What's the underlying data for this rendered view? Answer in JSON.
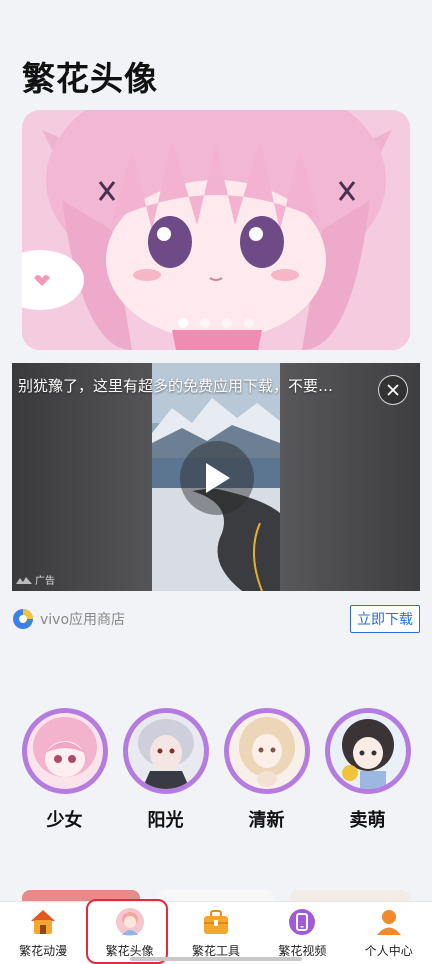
{
  "header": {
    "title": "繁花头像"
  },
  "banner": {
    "slide_count": 4,
    "active_index": 0
  },
  "ad": {
    "title": "别犹豫了，这里有超多的免费应用下载，不要…",
    "tag": "广告",
    "store_name": "vivo应用商店",
    "download_label": "立即下载"
  },
  "categories": [
    {
      "label": "少女"
    },
    {
      "label": "阳光"
    },
    {
      "label": "清新"
    },
    {
      "label": "卖萌"
    }
  ],
  "tabbar": {
    "active": "繁花头像",
    "tabs": [
      {
        "label": "繁花动漫",
        "icon": "home-icon"
      },
      {
        "label": "繁花头像",
        "icon": "avatar-icon"
      },
      {
        "label": "繁花工具",
        "icon": "toolbox-icon"
      },
      {
        "label": "繁花视频",
        "icon": "phone-video-icon"
      },
      {
        "label": "个人中心",
        "icon": "person-icon"
      }
    ]
  },
  "colors": {
    "accent_purple": "#b57ce0",
    "download_blue": "#2c6ed6",
    "highlight_red": "#e02b3b",
    "tab_orange": "#f08a2a"
  }
}
